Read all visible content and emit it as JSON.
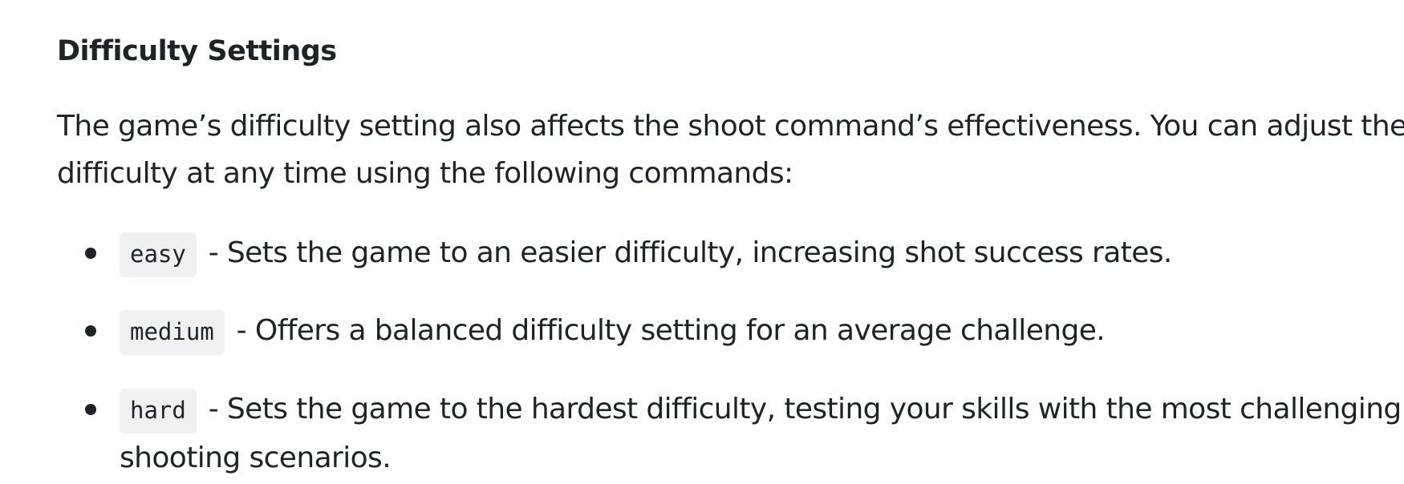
{
  "heading": "Difficulty Settings",
  "intro": {
    "line1": "The game’s difficulty setting also affects the shoot command’s effectiveness. You can adjust the",
    "line2": "difficulty at any time using the following commands:"
  },
  "commands": [
    {
      "code": "easy",
      "description": "- Sets the game to an easier difficulty, increasing shot success rates."
    },
    {
      "code": "medium",
      "description": "- Offers a balanced difficulty setting for an average challenge."
    },
    {
      "code": "hard",
      "description": "- Sets the game to the hardest difficulty, testing your skills with the most challenging",
      "description_cont": "shooting scenarios."
    }
  ],
  "colors": {
    "text": "#1f2328",
    "code_background": "#f0f0f0",
    "page_background": "#ffffff"
  }
}
